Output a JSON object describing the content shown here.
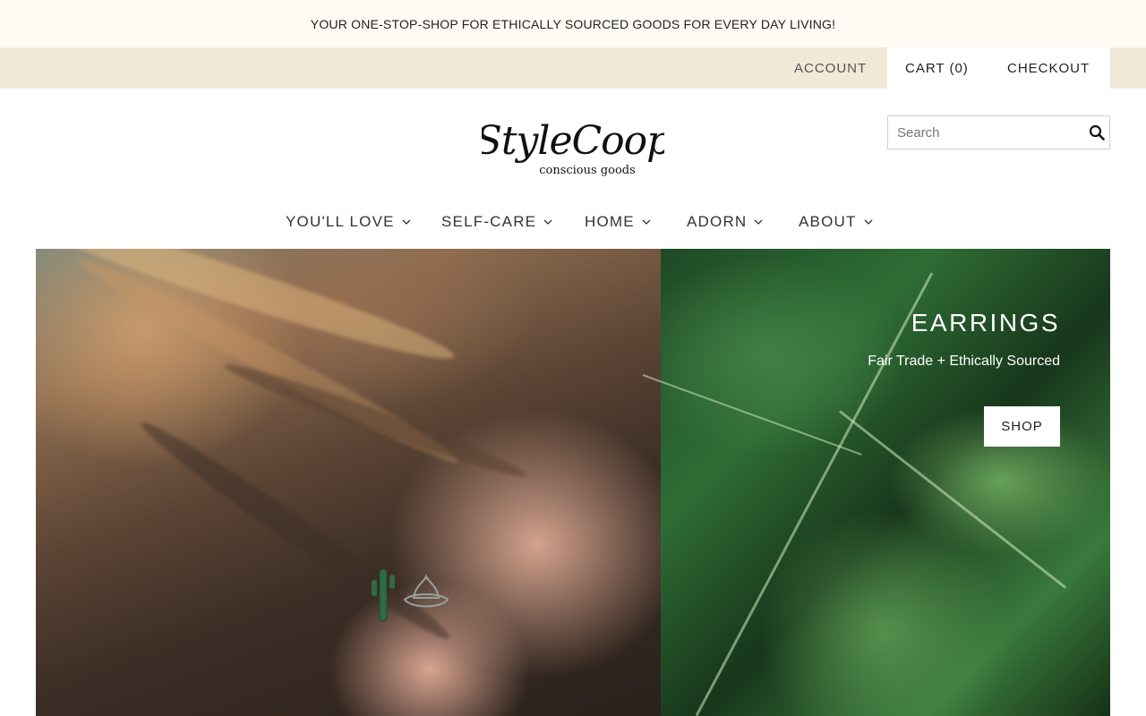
{
  "announcement": {
    "text": "YOUR ONE-STOP-SHOP FOR ETHICALLY SOURCED GOODS FOR EVERY DAY LIVING!"
  },
  "account_bar": {
    "account_label": "ACCOUNT",
    "cart_label": "CART (0)",
    "checkout_label": "CHECKOUT",
    "background_color": "#f2e8d8"
  },
  "logo": {
    "name": "StyleCoop",
    "tagline": "conscious goods"
  },
  "search": {
    "placeholder": "Search",
    "value": ""
  },
  "nav": {
    "items": [
      {
        "label": "YOU'LL LOVE"
      },
      {
        "label": "SELF-CARE"
      },
      {
        "label": "HOME"
      },
      {
        "label": "ADORN"
      },
      {
        "label": "ABOUT"
      }
    ]
  },
  "hero": {
    "title": "EARRINGS",
    "subtitle": "Fair Trade + Ethically Sourced",
    "button_label": "SHOP",
    "left_image": "woman-ear-with-cactus-and-lotus-earrings",
    "right_image": "banana-leaves-green"
  },
  "colors": {
    "announcement_bg": "#fffaf3",
    "account_bar_bg": "#f2e8d8",
    "hero_text": "#ffffff"
  }
}
